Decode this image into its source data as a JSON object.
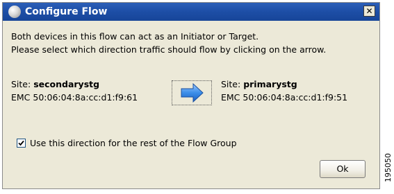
{
  "window": {
    "title": "Configure Flow",
    "close_label": "✕"
  },
  "message": {
    "line1": "Both devices in this flow can act as an Initiator or Target.",
    "line2": "Please select which direction traffic should flow by clicking on the arrow."
  },
  "source_site": {
    "label": "Site: ",
    "name": "secondarystg",
    "wwn": "EMC 50:06:04:8a:cc:d1:f9:61"
  },
  "target_site": {
    "label": "Site: ",
    "name": "primarystg",
    "wwn": "EMC 50:06:04:8a:cc:d1:f9:51"
  },
  "direction_arrow": {
    "icon": "arrow-right-icon",
    "color": "#3b8ee8"
  },
  "checkbox": {
    "checked": true,
    "label": "Use this direction for the rest of the Flow Group"
  },
  "ok_button": {
    "label": "Ok"
  },
  "figure_number": "195050"
}
